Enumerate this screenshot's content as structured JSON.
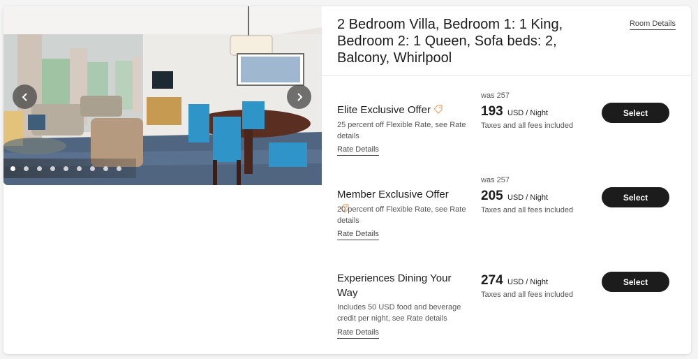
{
  "room": {
    "title": "2 Bedroom Villa, Bedroom 1: 1 King, Bedroom 2: 1 Queen, Sofa beds: 2, Balcony, Whirlpool",
    "details_link": "Room Details"
  },
  "carousel": {
    "prev_icon": "chevron-left-icon",
    "next_icon": "chevron-right-icon",
    "dot_count": 9,
    "active_dot": 0
  },
  "rates": [
    {
      "name": "Elite Exclusive Offer",
      "has_tag": true,
      "description": "25 percent off Flexible Rate, see Rate details",
      "link": "Rate Details",
      "was": "was 257",
      "price": "193",
      "unit": "USD / Night",
      "taxes": "Taxes and all fees included",
      "button": "Select"
    },
    {
      "name": "Member Exclusive Offer",
      "has_tag": true,
      "description": "20 percent off Flexible Rate, see Rate details",
      "link": "Rate Details",
      "was": "was 257",
      "price": "205",
      "unit": "USD / Night",
      "taxes": "Taxes and all fees included",
      "button": "Select"
    },
    {
      "name": "Experiences Dining Your Way",
      "has_tag": false,
      "description": "Includes 50 USD food and beverage credit per night, see Rate details",
      "link": "Rate Details",
      "was": "",
      "price": "274",
      "unit": "USD / Night",
      "taxes": "Taxes and all fees included",
      "button": "Select"
    }
  ],
  "colors": {
    "button_bg": "#1c1c1c",
    "tag_icon": "#e8a26a"
  }
}
